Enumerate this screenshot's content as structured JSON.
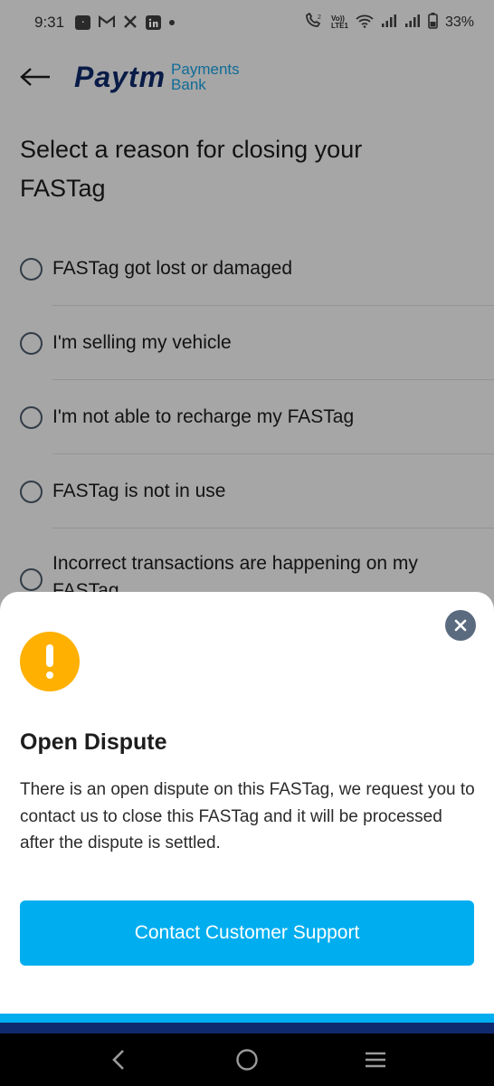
{
  "status_bar": {
    "time": "9:31",
    "left_icons": [
      "paytm-notification-icon",
      "gmail-icon",
      "x-icon",
      "linkedin-icon",
      "dot-icon"
    ],
    "right_icons": [
      "volte-call-icon",
      "wifi-icon",
      "signal-icon",
      "signal-icon",
      "battery-icon"
    ],
    "volte_label": "Vo)) LTE1",
    "call_sup": "2",
    "battery": "33%"
  },
  "header": {
    "logo_main": "Paytm",
    "logo_sub_1": "Payments",
    "logo_sub_2": "Bank"
  },
  "page": {
    "title": "Select a reason for closing your FASTag",
    "reasons": [
      {
        "label": "FASTag got lost or damaged"
      },
      {
        "label": "I'm selling my vehicle"
      },
      {
        "label": "I'm not able to recharge my FASTag"
      },
      {
        "label": "FASTag is not in use"
      },
      {
        "label": "Incorrect transactions are happening on my FASTag"
      }
    ]
  },
  "sheet": {
    "title": "Open Dispute",
    "message": "There is an open dispute on this FASTag, we request you to contact us to close this FASTag and it will be processed after the dispute is settled.",
    "cta_label": "Contact Customer Support",
    "alert_color": "#ffb000",
    "cta_color": "#00aef0"
  },
  "nav": {
    "buttons": [
      "back-icon",
      "home-icon",
      "recents-icon"
    ]
  },
  "colors": {
    "brand_dark": "#0f2a6e",
    "brand_light": "#00aef0"
  }
}
